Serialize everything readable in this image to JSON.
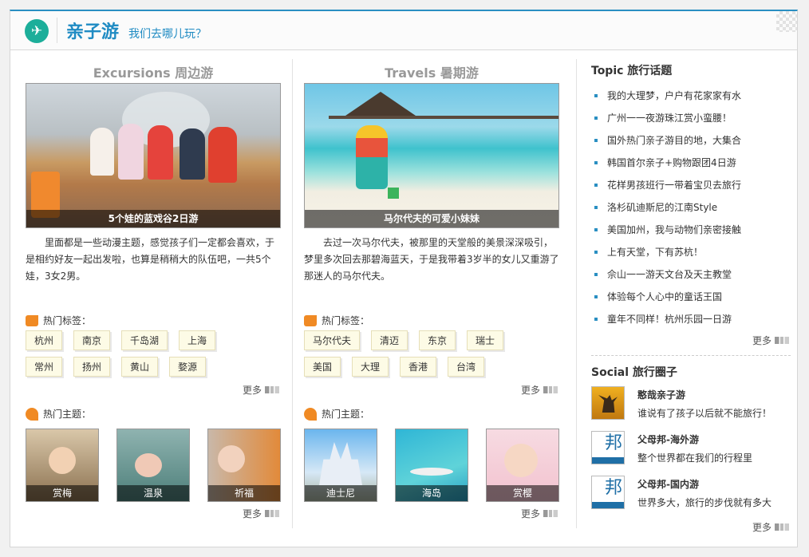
{
  "header": {
    "title": "亲子游",
    "subtitle": "我们去哪儿玩？"
  },
  "excursions": {
    "title": "Excursions 周边游",
    "photo_caption": "5个娃的蓝戏谷2日游",
    "description": "里面都是一些动漫主题，感觉孩子们一定都会喜欢，于是相约好友一起出发啦，也算是稍稍大的队伍吧，一共5个娃，3女2男。",
    "tags_label": "热门标签：",
    "tags": [
      "杭州",
      "南京",
      "千岛湖",
      "上海",
      "常州",
      "扬州",
      "黄山",
      "婺源"
    ],
    "more": "更多",
    "topics_label": "热门主题：",
    "topics": [
      "赏梅",
      "温泉",
      "祈福"
    ]
  },
  "travels": {
    "title": "Travels 暑期游",
    "photo_caption": "马尔代夫的可爱小妹妹",
    "description": "去过一次马尔代夫，被那里的天堂般的美景深深吸引，梦里多次回去那碧海蓝天，于是我带着3岁半的女儿又重游了那迷人的马尔代夫。",
    "tags_label": "热门标签：",
    "tags": [
      "马尔代夫",
      "清迈",
      "东京",
      "瑞士",
      "美国",
      "大理",
      "香港",
      "台湾"
    ],
    "more": "更多",
    "topics_label": "热门主题：",
    "topics": [
      "迪士尼",
      "海岛",
      "赏樱"
    ]
  },
  "topic": {
    "title": "Topic 旅行话题",
    "items": [
      "我的大理梦，户户有花家家有水",
      "广州一一夜游珠江赏小蛮腰！",
      "国外热门亲子游目的地，大集合",
      "韩国首尔亲子+购物跟团4日游",
      "花样男孩班行一带着宝贝去旅行",
      "洛杉矶迪斯尼的江南Style",
      "美国加州，我与动物们亲密接触",
      "上有天堂，下有苏杭！",
      "佘山一一游天文台及天主教堂",
      "体验每个人心中的童话王国",
      "童年不同样！杭州乐园一日游"
    ],
    "more": "更多"
  },
  "social": {
    "title": "Social 旅行圈子",
    "items": [
      {
        "name": "憨哉亲子游",
        "desc": "谁说有了孩子以后就不能旅行！",
        "avatar_text": ""
      },
      {
        "name": "父母邦-海外游",
        "desc": "整个世界都在我们的行程里",
        "avatar_text": "邦"
      },
      {
        "name": "父母邦-国内游",
        "desc": "世界多大，旅行的步伐就有多大",
        "avatar_text": "邦"
      }
    ],
    "more": "更多"
  },
  "colors": {
    "accent": "#1f8bc3",
    "orange": "#f08a24",
    "teal": "#1cae9a"
  }
}
